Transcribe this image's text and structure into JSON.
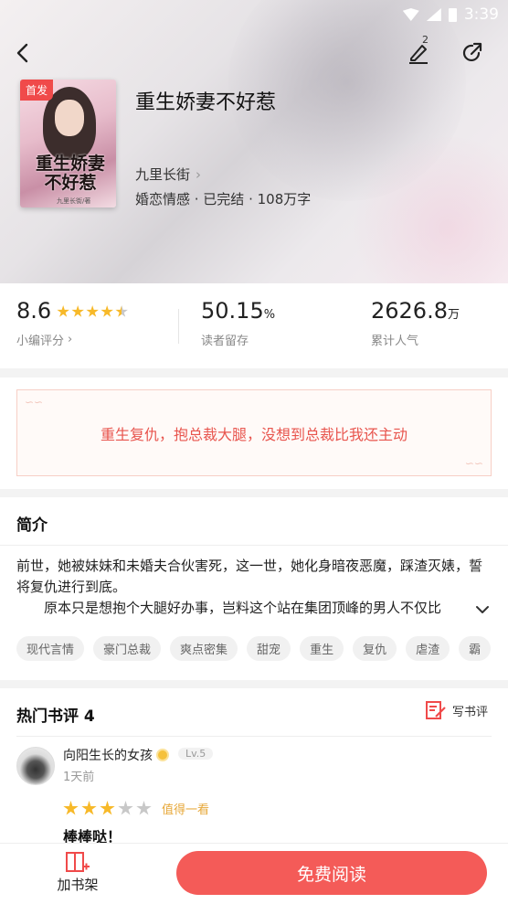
{
  "status_bar": {
    "time": "3:39"
  },
  "header": {
    "edit_badge": "2",
    "book_title": "重生娇妻不好惹",
    "author": "九里长街",
    "meta": "婚恋情感 · 已完结 · 108万字",
    "first_badge": "首发",
    "cover": {
      "title": "重生娇妻不好惹",
      "author": "九里长街/著"
    }
  },
  "stats": {
    "score": {
      "value": "8.6",
      "label": "小编评分",
      "stars": 4.5
    },
    "retention": {
      "value": "50.15",
      "unit": "%",
      "label": "读者留存"
    },
    "popularity": {
      "value": "2626.8",
      "unit": "万",
      "label": "累计人气"
    }
  },
  "slogan": "重生复仇，抱总裁大腿，没想到总裁比我还主动",
  "intro": {
    "title": "简介",
    "line1": "前世，她被妹妹和未婚夫合伙害死，这一世，她化身暗夜恶魔，踩渣灭婊，誓将复仇进行到底。",
    "line2": "原本只是想抱个大腿好办事，岂料这个站在集团顶峰的男人不仅比",
    "tags": [
      "现代言情",
      "豪门总裁",
      "爽点密集",
      "甜宠",
      "重生",
      "复仇",
      "虐渣",
      "霸"
    ]
  },
  "reviews": {
    "title": "热门书评 4",
    "write_label": "写书评",
    "items": [
      {
        "name": "向阳生长的女孩",
        "level": "Lv.5",
        "time": "1天前",
        "rating": 3,
        "verdict": "值得一看",
        "text": "棒棒哒！"
      }
    ]
  },
  "bottom": {
    "add_shelf": "加书架",
    "read": "免费阅读"
  },
  "colors": {
    "accent": "#f45b58",
    "star": "#f7b929",
    "slogan": "#e8554e"
  }
}
